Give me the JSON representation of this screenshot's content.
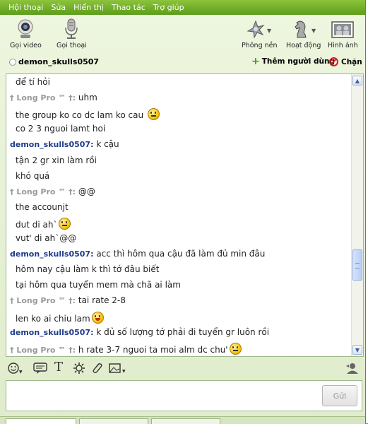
{
  "menu": [
    "Hội thoại",
    "Sửa",
    "Hiển thị",
    "Thao tác",
    "Trợ giúp"
  ],
  "toolbar": {
    "video_label": "Gọi video",
    "voice_label": "Gọi thoại",
    "background_label": "Phông nền",
    "activities_label": "Hoạt động",
    "images_label": "Hình ảnh"
  },
  "contact": {
    "name": "demon_skulls0507",
    "add_user_label": "Thêm người dùng",
    "block_label": "Chặn"
  },
  "messages": [
    {
      "type": "text",
      "text": "để tí hỏi"
    },
    {
      "type": "sender",
      "who": "long",
      "sender": "† Long Pro ™ †:",
      "text": "uhm"
    },
    {
      "type": "text",
      "text": "the group ko co dc lam ko cau ",
      "emoticon": "smile"
    },
    {
      "type": "text",
      "text": "co 2 3 nguoi lamt hoi"
    },
    {
      "type": "sender",
      "who": "demon",
      "sender": "demon_skulls0507:",
      "text": "k cậu"
    },
    {
      "type": "text",
      "text": "tận 2 gr xin làm rồi"
    },
    {
      "type": "text",
      "text": "khó quá"
    },
    {
      "type": "sender",
      "who": "long",
      "sender": "† Long Pro ™ †:",
      "text": "@@"
    },
    {
      "type": "text",
      "text": "the accounjt"
    },
    {
      "type": "text",
      "text": "dut di ah`",
      "emoticon": "smile"
    },
    {
      "type": "text",
      "text": "vut' di ah`@@"
    },
    {
      "type": "sender",
      "who": "demon",
      "sender": "demon_skulls0507:",
      "text": "acc thì hôm qua cậu đã làm đủ min đâu"
    },
    {
      "type": "text",
      "text": "hôm nay cậu làm k thì tớ đâu biết"
    },
    {
      "type": "text",
      "text": "tại hôm qua tuyển mem mà chã ai làm"
    },
    {
      "type": "sender",
      "who": "long",
      "sender": "† Long Pro ™ †:",
      "text": "tai rate 2-8"
    },
    {
      "type": "text",
      "text": "len ko ai chiu lam",
      "emoticon": "laugh"
    },
    {
      "type": "sender",
      "who": "demon",
      "sender": "demon_skulls0507:",
      "text": "k đủ số lượng tớ phải đi tuyển gr luôn rồi"
    },
    {
      "type": "sender",
      "who": "long",
      "sender": "† Long Pro ™ †:",
      "text": "h rate 3-7 nguoi ta moi alm dc chu'",
      "emoticon": "smile"
    }
  ],
  "scroll_position": 0.72,
  "format_icons": [
    "emoticon-icon",
    "message-style-icon",
    "text-format-icon",
    "settings-icon",
    "attach-icon",
    "image-icon",
    "contact-icon"
  ],
  "text_icon_glyph": "T",
  "send_label": "Gửi",
  "colors": {
    "menu_green": "#6aa51f",
    "sender_blue": "#1f3b8a",
    "sender_gray": "#888888"
  }
}
